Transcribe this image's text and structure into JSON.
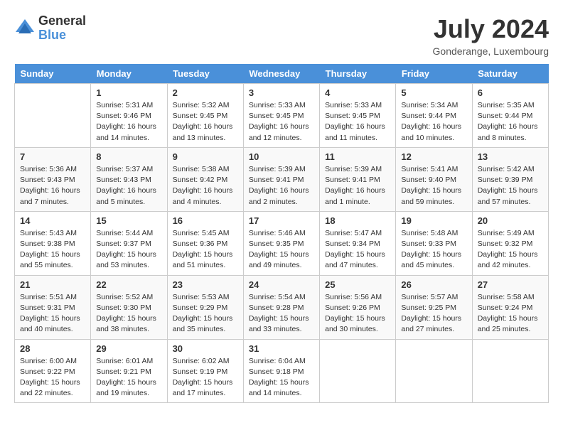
{
  "header": {
    "logo_general": "General",
    "logo_blue": "Blue",
    "month_title": "July 2024",
    "location": "Gonderange, Luxembourg"
  },
  "days_of_week": [
    "Sunday",
    "Monday",
    "Tuesday",
    "Wednesday",
    "Thursday",
    "Friday",
    "Saturday"
  ],
  "weeks": [
    [
      {
        "day": "",
        "info": ""
      },
      {
        "day": "1",
        "info": "Sunrise: 5:31 AM\nSunset: 9:46 PM\nDaylight: 16 hours\nand 14 minutes."
      },
      {
        "day": "2",
        "info": "Sunrise: 5:32 AM\nSunset: 9:45 PM\nDaylight: 16 hours\nand 13 minutes."
      },
      {
        "day": "3",
        "info": "Sunrise: 5:33 AM\nSunset: 9:45 PM\nDaylight: 16 hours\nand 12 minutes."
      },
      {
        "day": "4",
        "info": "Sunrise: 5:33 AM\nSunset: 9:45 PM\nDaylight: 16 hours\nand 11 minutes."
      },
      {
        "day": "5",
        "info": "Sunrise: 5:34 AM\nSunset: 9:44 PM\nDaylight: 16 hours\nand 10 minutes."
      },
      {
        "day": "6",
        "info": "Sunrise: 5:35 AM\nSunset: 9:44 PM\nDaylight: 16 hours\nand 8 minutes."
      }
    ],
    [
      {
        "day": "7",
        "info": "Sunrise: 5:36 AM\nSunset: 9:43 PM\nDaylight: 16 hours\nand 7 minutes."
      },
      {
        "day": "8",
        "info": "Sunrise: 5:37 AM\nSunset: 9:43 PM\nDaylight: 16 hours\nand 5 minutes."
      },
      {
        "day": "9",
        "info": "Sunrise: 5:38 AM\nSunset: 9:42 PM\nDaylight: 16 hours\nand 4 minutes."
      },
      {
        "day": "10",
        "info": "Sunrise: 5:39 AM\nSunset: 9:41 PM\nDaylight: 16 hours\nand 2 minutes."
      },
      {
        "day": "11",
        "info": "Sunrise: 5:39 AM\nSunset: 9:41 PM\nDaylight: 16 hours\nand 1 minute."
      },
      {
        "day": "12",
        "info": "Sunrise: 5:41 AM\nSunset: 9:40 PM\nDaylight: 15 hours\nand 59 minutes."
      },
      {
        "day": "13",
        "info": "Sunrise: 5:42 AM\nSunset: 9:39 PM\nDaylight: 15 hours\nand 57 minutes."
      }
    ],
    [
      {
        "day": "14",
        "info": "Sunrise: 5:43 AM\nSunset: 9:38 PM\nDaylight: 15 hours\nand 55 minutes."
      },
      {
        "day": "15",
        "info": "Sunrise: 5:44 AM\nSunset: 9:37 PM\nDaylight: 15 hours\nand 53 minutes."
      },
      {
        "day": "16",
        "info": "Sunrise: 5:45 AM\nSunset: 9:36 PM\nDaylight: 15 hours\nand 51 minutes."
      },
      {
        "day": "17",
        "info": "Sunrise: 5:46 AM\nSunset: 9:35 PM\nDaylight: 15 hours\nand 49 minutes."
      },
      {
        "day": "18",
        "info": "Sunrise: 5:47 AM\nSunset: 9:34 PM\nDaylight: 15 hours\nand 47 minutes."
      },
      {
        "day": "19",
        "info": "Sunrise: 5:48 AM\nSunset: 9:33 PM\nDaylight: 15 hours\nand 45 minutes."
      },
      {
        "day": "20",
        "info": "Sunrise: 5:49 AM\nSunset: 9:32 PM\nDaylight: 15 hours\nand 42 minutes."
      }
    ],
    [
      {
        "day": "21",
        "info": "Sunrise: 5:51 AM\nSunset: 9:31 PM\nDaylight: 15 hours\nand 40 minutes."
      },
      {
        "day": "22",
        "info": "Sunrise: 5:52 AM\nSunset: 9:30 PM\nDaylight: 15 hours\nand 38 minutes."
      },
      {
        "day": "23",
        "info": "Sunrise: 5:53 AM\nSunset: 9:29 PM\nDaylight: 15 hours\nand 35 minutes."
      },
      {
        "day": "24",
        "info": "Sunrise: 5:54 AM\nSunset: 9:28 PM\nDaylight: 15 hours\nand 33 minutes."
      },
      {
        "day": "25",
        "info": "Sunrise: 5:56 AM\nSunset: 9:26 PM\nDaylight: 15 hours\nand 30 minutes."
      },
      {
        "day": "26",
        "info": "Sunrise: 5:57 AM\nSunset: 9:25 PM\nDaylight: 15 hours\nand 27 minutes."
      },
      {
        "day": "27",
        "info": "Sunrise: 5:58 AM\nSunset: 9:24 PM\nDaylight: 15 hours\nand 25 minutes."
      }
    ],
    [
      {
        "day": "28",
        "info": "Sunrise: 6:00 AM\nSunset: 9:22 PM\nDaylight: 15 hours\nand 22 minutes."
      },
      {
        "day": "29",
        "info": "Sunrise: 6:01 AM\nSunset: 9:21 PM\nDaylight: 15 hours\nand 19 minutes."
      },
      {
        "day": "30",
        "info": "Sunrise: 6:02 AM\nSunset: 9:19 PM\nDaylight: 15 hours\nand 17 minutes."
      },
      {
        "day": "31",
        "info": "Sunrise: 6:04 AM\nSunset: 9:18 PM\nDaylight: 15 hours\nand 14 minutes."
      },
      {
        "day": "",
        "info": ""
      },
      {
        "day": "",
        "info": ""
      },
      {
        "day": "",
        "info": ""
      }
    ]
  ]
}
